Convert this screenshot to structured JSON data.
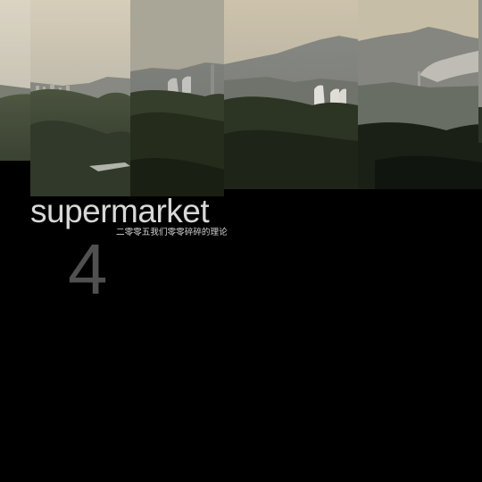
{
  "cover": {
    "title": "supermarket",
    "subtitle": "二零零五我们零零碎碎的理论",
    "issue_number": "4"
  },
  "colors": {
    "background": "#000000",
    "title": "#d8d8d8",
    "issue_number": "#505050",
    "sky_top": "#cfc8b4",
    "haze": "#a9a79b",
    "hills_dark": "#2b3322"
  }
}
